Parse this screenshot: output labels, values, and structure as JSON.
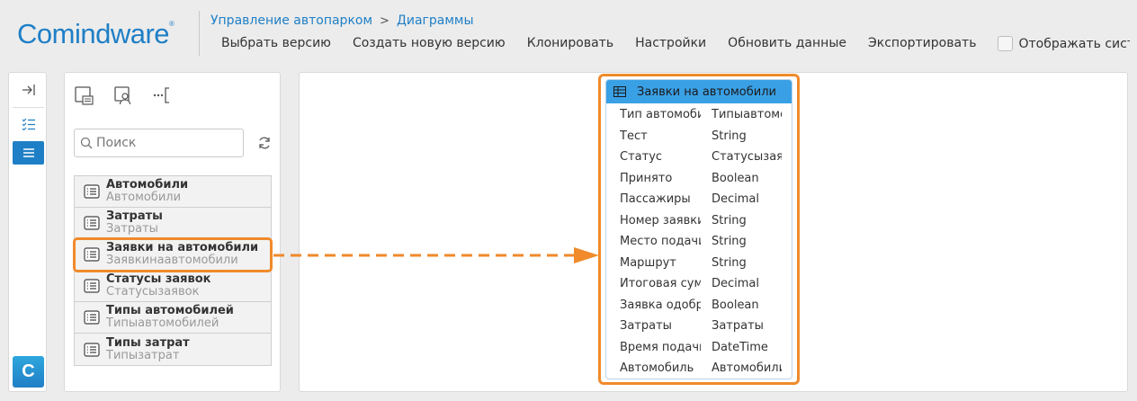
{
  "app": {
    "logo": "Comindware",
    "logo_mark": "®"
  },
  "breadcrumb": {
    "parent": "Управление автопарком",
    "separator": ">",
    "current": "Диаграммы"
  },
  "toolbar": {
    "select_version": "Выбрать версию",
    "new_version": "Создать новую версию",
    "clone": "Клонировать",
    "settings": "Настройки",
    "refresh_data": "Обновить данные",
    "export": "Экспортировать",
    "show_system": "Отображать системные и"
  },
  "rail": {
    "logo_letter": "C"
  },
  "panel": {
    "search_placeholder": "Поиск",
    "entities": [
      {
        "name": "Автомобили",
        "alias": "Автомобили"
      },
      {
        "name": "Затраты",
        "alias": "Затраты"
      },
      {
        "name": "Заявки на автомобили",
        "alias": "Заявкинаавтомобили"
      },
      {
        "name": "Статусы заявок",
        "alias": "Статусызаявок"
      },
      {
        "name": "Типы автомобилей",
        "alias": "Типыавтомобилей"
      },
      {
        "name": "Типы затрат",
        "alias": "Типызатрат"
      }
    ]
  },
  "diagram": {
    "title": "Заявки на автомобили",
    "fields": [
      {
        "name": "Тип автомобиля",
        "type": "Типыавтомобилей"
      },
      {
        "name": "Тест",
        "type": "String"
      },
      {
        "name": "Статус",
        "type": "Статусызаявок"
      },
      {
        "name": "Принято",
        "type": "Boolean"
      },
      {
        "name": "Пассажиры",
        "type": "Decimal"
      },
      {
        "name": "Номер заявки",
        "type": "String"
      },
      {
        "name": "Место подачи",
        "type": "String"
      },
      {
        "name": "Маршрут",
        "type": "String"
      },
      {
        "name": "Итоговая сумма",
        "type": "Decimal"
      },
      {
        "name": "Заявка одобрена",
        "type": "Boolean"
      },
      {
        "name": "Затраты",
        "type": "Затраты"
      },
      {
        "name": "Время подачи",
        "type": "DateTime"
      },
      {
        "name": "Автомобиль",
        "type": "Автомобили"
      }
    ]
  },
  "colors": {
    "accent": "#1f7fc6",
    "highlight": "#f08a2b",
    "card_header": "#3aa0e6"
  }
}
